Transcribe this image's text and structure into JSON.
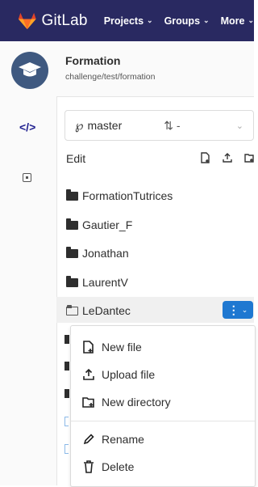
{
  "header": {
    "brand": "GitLab",
    "nav": [
      {
        "label": "Projects"
      },
      {
        "label": "Groups"
      },
      {
        "label": "More"
      }
    ]
  },
  "project": {
    "name": "Formation",
    "path": "challenge/test/formation"
  },
  "branch_selector": {
    "branch": "master",
    "mr_count": "-"
  },
  "toolbar": {
    "edit_label": "Edit"
  },
  "tree": {
    "items": [
      {
        "name": "FormationTutrices",
        "type": "folder"
      },
      {
        "name": "Gautier_F",
        "type": "folder"
      },
      {
        "name": "Jonathan",
        "type": "folder"
      },
      {
        "name": "LaurentV",
        "type": "folder"
      },
      {
        "name": "LeDantec",
        "type": "folder-open"
      }
    ]
  },
  "context_menu": {
    "items": [
      {
        "label": "New file",
        "icon": "new-file-icon"
      },
      {
        "label": "Upload file",
        "icon": "upload-icon"
      },
      {
        "label": "New directory",
        "icon": "new-directory-icon"
      },
      {
        "label": "Rename",
        "icon": "pencil-icon"
      },
      {
        "label": "Delete",
        "icon": "trash-icon"
      }
    ]
  },
  "colors": {
    "topbar": "#292961",
    "accent": "#1f78d1",
    "logo": "#e24329"
  }
}
